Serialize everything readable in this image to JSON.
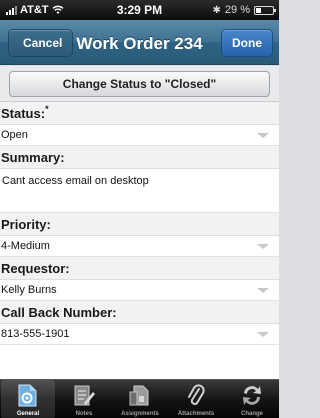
{
  "status_bar": {
    "carrier": "AT&T",
    "time": "3:29 PM",
    "battery": "29 %"
  },
  "nav": {
    "cancel_label": "Cancel",
    "title": "Work Order 234",
    "done_label": "Done"
  },
  "action": {
    "change_status_label": "Change Status to \"Closed\""
  },
  "form": {
    "status": {
      "label": "Status:",
      "required_mark": "*",
      "value": "Open"
    },
    "summary": {
      "label": "Summary:",
      "value": "Cant access email on desktop"
    },
    "priority": {
      "label": "Priority:",
      "value": "4-Medium"
    },
    "requestor": {
      "label": "Requestor:",
      "value": "Kelly Burns"
    },
    "call_back": {
      "label": "Call Back Number:",
      "value": "813-555-1901"
    }
  },
  "tabs": [
    {
      "label": "General",
      "icon": "general-icon",
      "active": true
    },
    {
      "label": "Notes",
      "icon": "notes-icon",
      "active": false
    },
    {
      "label": "Assignments",
      "icon": "assignments-icon",
      "active": false
    },
    {
      "label": "Attachments",
      "icon": "paperclip-icon",
      "active": false
    },
    {
      "label": "Change",
      "icon": "change-icon",
      "active": false
    }
  ],
  "colors": {
    "nav": "#3e7090",
    "done": "#2563b0",
    "tab_active": "#6fb0e0"
  }
}
